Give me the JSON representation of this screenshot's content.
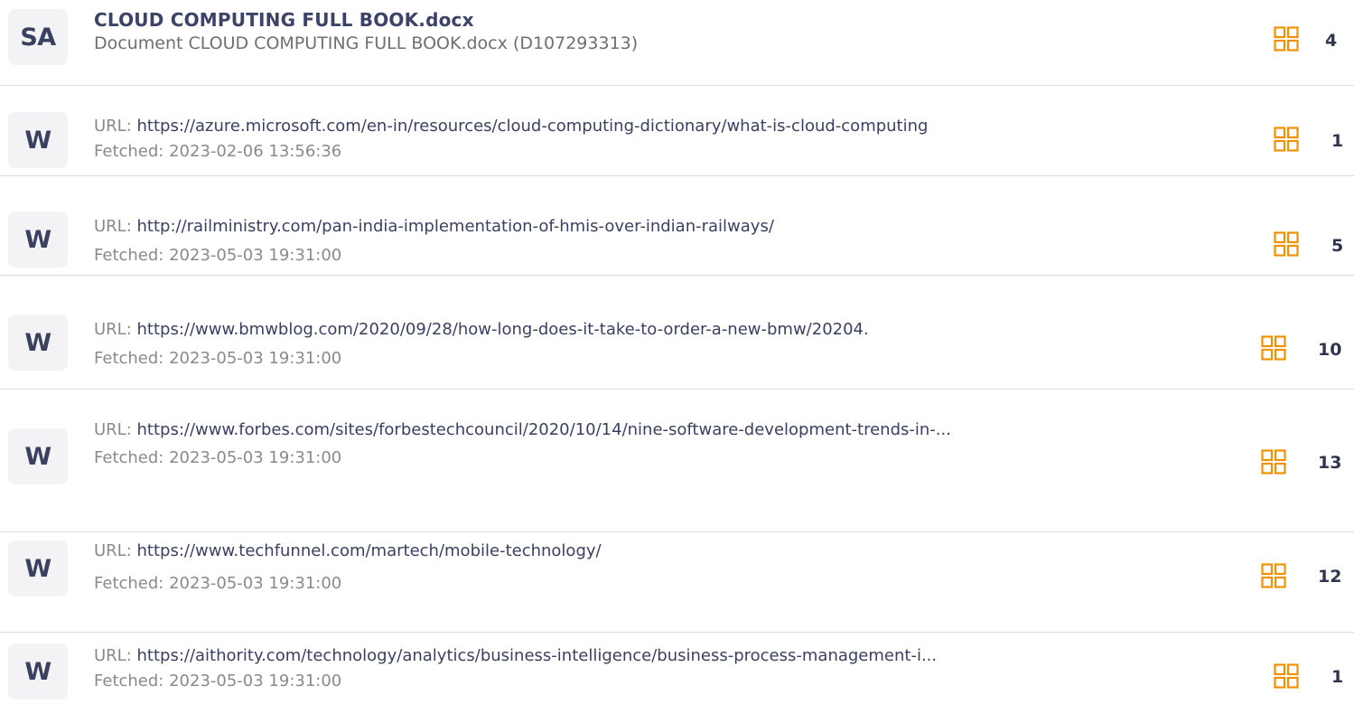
{
  "sources": [
    {
      "type": "doc",
      "badge": "SA",
      "title": "CLOUD COMPUTING FULL BOOK.docx",
      "subtitle": "Document CLOUD COMPUTING FULL BOOK.docx (D107293313)",
      "count": "4"
    },
    {
      "type": "web",
      "badge": "W",
      "url_prefix": "URL: ",
      "url": "https://azure.microsoft.com/en-in/resources/cloud-computing-dictionary/what-is-cloud-computing",
      "fetched": "Fetched: 2023-02-06 13:56:36",
      "count": "1"
    },
    {
      "type": "web",
      "badge": "W",
      "url_prefix": "URL: ",
      "url": "http://railministry.com/pan-india-implementation-of-hmis-over-indian-railways/",
      "fetched": "Fetched: 2023-05-03 19:31:00",
      "count": "5"
    },
    {
      "type": "web",
      "badge": "W",
      "url_prefix": "URL: ",
      "url": "https://www.bmwblog.com/2020/09/28/how-long-does-it-take-to-order-a-new-bmw/20204.",
      "fetched": "Fetched: 2023-05-03 19:31:00",
      "count": "10"
    },
    {
      "type": "web",
      "badge": "W",
      "url_prefix": "URL: ",
      "url": "https://www.forbes.com/sites/forbestechcouncil/2020/10/14/nine-software-development-trends-in-...",
      "fetched": "Fetched: 2023-05-03 19:31:00",
      "count": "13"
    },
    {
      "type": "web",
      "badge": "W",
      "url_prefix": "URL: ",
      "url": "https://www.techfunnel.com/martech/mobile-technology/",
      "fetched": "Fetched: 2023-05-03 19:31:00",
      "count": "12"
    },
    {
      "type": "web",
      "badge": "W",
      "url_prefix": "URL: ",
      "url": "https://aithority.com/technology/analytics/business-intelligence/business-process-management-i...",
      "fetched": "Fetched: 2023-05-03 19:31:00",
      "count": "1"
    }
  ],
  "icons": {
    "type_badge": "source-type-icon",
    "match": "matches-grid-icon"
  },
  "colors": {
    "accent_orange": "#f29100",
    "title_navy": "#3c4268",
    "badge_bg": "#f3f3f5"
  }
}
